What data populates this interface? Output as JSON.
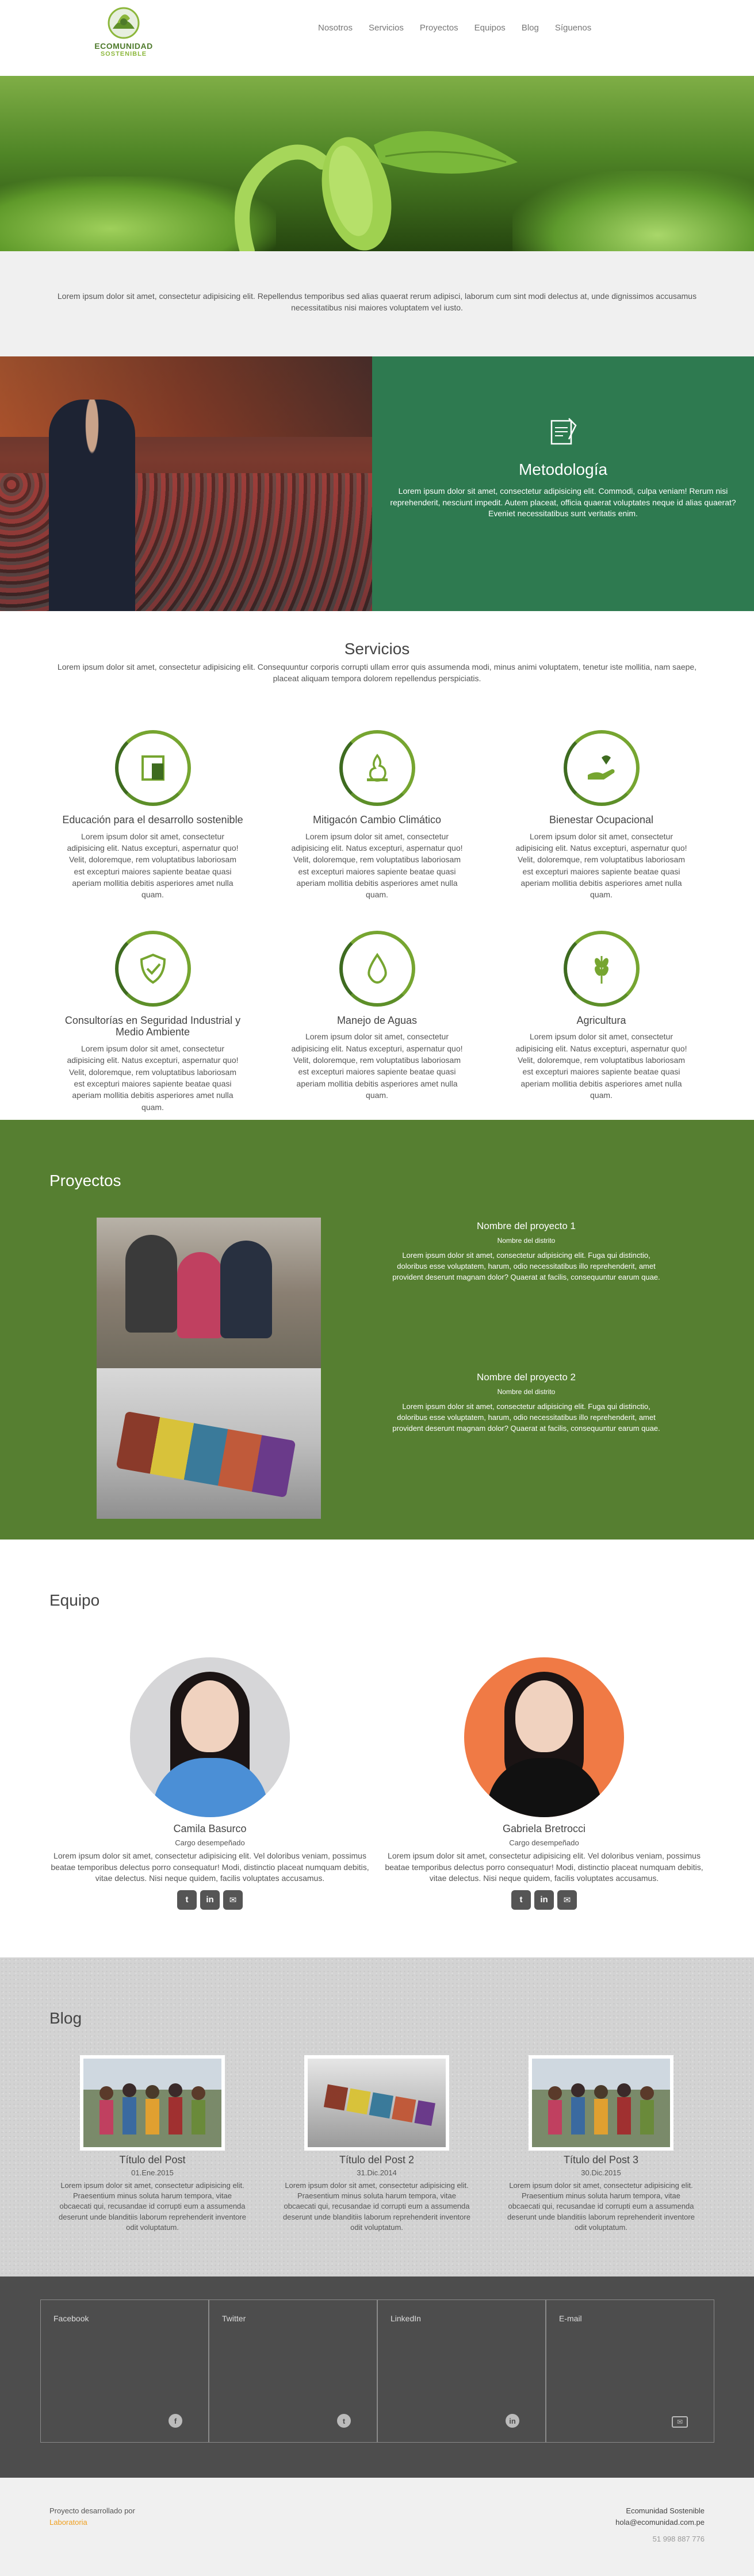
{
  "brand": {
    "line1": "ECOMUNIDAD",
    "line2": "SOSTENIBLE"
  },
  "nav": [
    "Nosotros",
    "Servicios",
    "Proyectos",
    "Equipos",
    "Blog",
    "Síguenos"
  ],
  "intro": "Lorem ipsum dolor sit amet, consectetur adipisicing elit. Repellendus temporibus sed alias quaerat rerum adipisci, laborum cum sint modi delectus at, unde dignissimos accusamus necessitatibus nisi maiores voluptatem vel iusto.",
  "metodologia": {
    "title": "Metodología",
    "text": "Lorem ipsum dolor sit amet, consectetur adipisicing elit. Commodi, culpa veniam! Rerum nisi reprehenderit, nesciunt impedit. Autem placeat, officia quaerat voluptates neque id alias quaerat? Eveniet necessitatibus sunt veritatis enim."
  },
  "servicios": {
    "title": "Servicios",
    "lead": "Lorem ipsum dolor sit amet, consectetur adipisicing elit. Consequuntur corporis corrupti ullam error quis assumenda modi, minus animi voluptatem, tenetur iste mollitia, nam saepe, placeat aliquam tempora dolorem repellendus perspiciatis.",
    "items": [
      {
        "title": "Educación para el desarrollo sostenible",
        "icon": "book-icon",
        "text": "Lorem ipsum dolor sit amet, consectetur adipisicing elit. Natus excepturi, aspernatur quo! Velit, doloremque, rem voluptatibus laboriosam est excepturi maiores sapiente beatae quasi aperiam mollitia debitis asperiores amet nulla quam."
      },
      {
        "title": "Mitigacón Cambio Climático",
        "icon": "flame-icon",
        "text": "Lorem ipsum dolor sit amet, consectetur adipisicing elit. Natus excepturi, aspernatur quo! Velit, doloremque, rem voluptatibus laboriosam est excepturi maiores sapiente beatae quasi aperiam mollitia debitis asperiores amet nulla quam."
      },
      {
        "title": "Bienestar Ocupacional",
        "icon": "hand-heart-icon",
        "text": "Lorem ipsum dolor sit amet, consectetur adipisicing elit. Natus excepturi, aspernatur quo! Velit, doloremque, rem voluptatibus laboriosam est excepturi maiores sapiente beatae quasi aperiam mollitia debitis asperiores amet nulla quam."
      },
      {
        "title": "Consultorías en Seguridad Industrial y Medio Ambiente",
        "icon": "shield-check-icon",
        "text": "Lorem ipsum dolor sit amet, consectetur adipisicing elit. Natus excepturi, aspernatur quo! Velit, doloremque, rem voluptatibus laboriosam est excepturi maiores sapiente beatae quasi aperiam mollitia debitis asperiores amet nulla quam."
      },
      {
        "title": "Manejo de Aguas",
        "icon": "water-drop-icon",
        "text": "Lorem ipsum dolor sit amet, consectetur adipisicing elit. Natus excepturi, aspernatur quo! Velit, doloremque, rem voluptatibus laboriosam est excepturi maiores sapiente beatae quasi aperiam mollitia debitis asperiores amet nulla quam."
      },
      {
        "title": "Agricultura",
        "icon": "wheat-icon",
        "text": "Lorem ipsum dolor sit amet, consectetur adipisicing elit. Natus excepturi, aspernatur quo! Velit, doloremque, rem voluptatibus laboriosam est excepturi maiores sapiente beatae quasi aperiam mollitia debitis asperiores amet nulla quam."
      }
    ]
  },
  "proyectos": {
    "title": "Proyectos",
    "items": [
      {
        "name": "Nombre del proyecto 1",
        "district": "Nombre del distrito",
        "text": "Lorem ipsum dolor sit amet, consectetur adipisicing elit. Fuga qui distinctio, doloribus esse voluptatem, harum, odio necessitatibus illo reprehenderit, amet provident deserunt magnam dolor? Quaerat at facilis, consequuntur earum quae."
      },
      {
        "name": "Nombre del proyecto 2",
        "district": "Nombre del distrito",
        "text": "Lorem ipsum dolor sit amet, consectetur adipisicing elit. Fuga qui distinctio, doloribus esse voluptatem, harum, odio necessitatibus illo reprehenderit, amet provident deserunt magnam dolor? Quaerat at facilis, consequuntur earum quae."
      }
    ]
  },
  "equipo": {
    "title": "Equipo",
    "members": [
      {
        "name": "Camila Basurco",
        "role": "Cargo desempeñado",
        "text": "Lorem ipsum dolor sit amet, consectetur adipisicing elit. Vel doloribus veniam, possimus beatae temporibus delectus porro consequatur! Modi, distinctio placeat numquam debitis, vitae delectus. Nisi neque quidem, facilis voluptates accusamus."
      },
      {
        "name": "Gabriela Bretrocci",
        "role": "Cargo desempeñado",
        "text": "Lorem ipsum dolor sit amet, consectetur adipisicing elit. Vel doloribus veniam, possimus beatae temporibus delectus porro consequatur! Modi, distinctio placeat numquam debitis, vitae delectus. Nisi neque quidem, facilis voluptates accusamus."
      }
    ],
    "social_icons": [
      "twitter-icon",
      "linkedin-icon",
      "email-icon"
    ]
  },
  "blog": {
    "title": "Blog",
    "posts": [
      {
        "title": "Título del Post",
        "date": "01.Ene.2015",
        "text": "Lorem ipsum dolor sit amet, consectetur adipisicing elit. Praesentium minus soluta harum tempora, vitae obcaecati qui, recusandae id corrupti eum a assumenda deserunt unde blanditiis laborum reprehenderit inventore odit voluptatum."
      },
      {
        "title": "Título del Post 2",
        "date": "31.Dic.2014",
        "text": "Lorem ipsum dolor sit amet, consectetur adipisicing elit. Praesentium minus soluta harum tempora, vitae obcaecati qui, recusandae id corrupti eum a assumenda deserunt unde blanditiis laborum reprehenderit inventore odit voluptatum."
      },
      {
        "title": "Título del Post 3",
        "date": "30.Dic.2015",
        "text": "Lorem ipsum dolor sit amet, consectetur adipisicing elit. Praesentium minus soluta harum tempora, vitae obcaecati qui, recusandae id corrupti eum a assumenda deserunt unde blanditiis laborum reprehenderit inventore odit voluptatum."
      }
    ]
  },
  "social_boxes": [
    {
      "label": "Facebook",
      "icon": "facebook-icon",
      "glyph": "f"
    },
    {
      "label": "Twitter",
      "icon": "twitter-icon",
      "glyph": "t"
    },
    {
      "label": "LinkedIn",
      "icon": "linkedin-icon",
      "glyph": "in"
    },
    {
      "label": "E-mail",
      "icon": "email-icon",
      "glyph": "✉"
    }
  ],
  "footer": {
    "credit": "Proyecto desarrollado por",
    "credit_name": "Laboratoria",
    "org": "Ecomunidad Sostenible",
    "email": "hola@ecomunidad.com.pe",
    "phone": "51 998 887 776"
  },
  "colors": {
    "brand_green": "#567f31",
    "teal_green": "#2e7a50",
    "accent_green": "#76a530",
    "footer_dark": "#4d4d4d",
    "credit_orange": "#f0a020"
  }
}
